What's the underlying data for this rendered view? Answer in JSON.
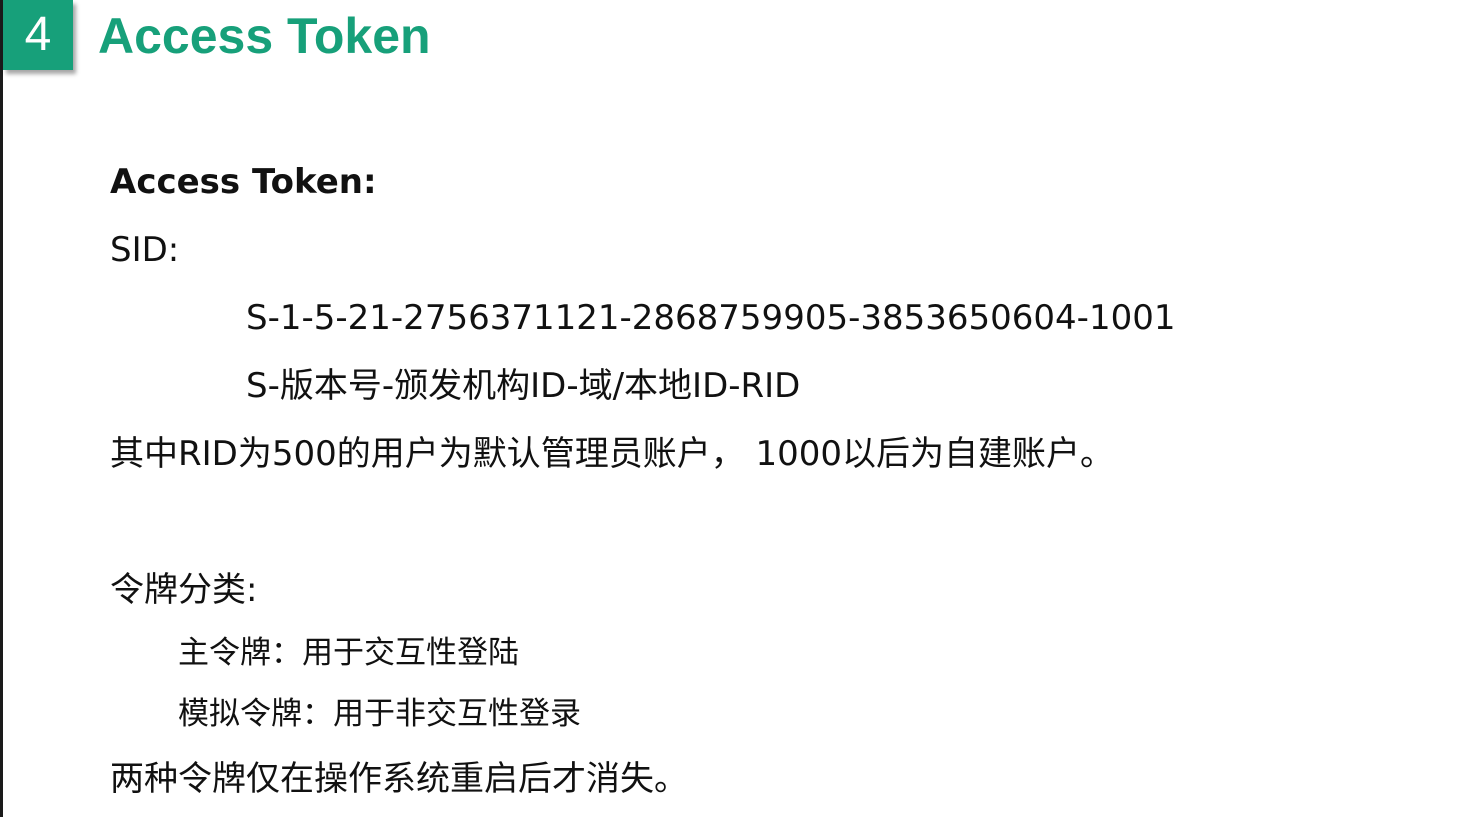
{
  "slide": {
    "number": "4",
    "title": "Access Token"
  },
  "content": {
    "heading": "Access Token:",
    "sid_label": "SID:",
    "sid_example": "S-1-5-21-2756371121-2868759905-3853650604-1001",
    "sid_format": "S-版本号-颁发机构ID-域/本地ID-RID",
    "rid_note": "其中RID为500的用户为默认管理员账户， 1000以后为自建账户。",
    "token_types_label": "令牌分类:",
    "primary_token": "主令牌：用于交互性登陆",
    "impersonation_token": "模拟令牌：用于非交互性登录",
    "closing_note": "两种令牌仅在操作系统重启后才消失。"
  },
  "colors": {
    "accent": "#17a07a",
    "text": "#111111",
    "background": "#ffffff"
  }
}
